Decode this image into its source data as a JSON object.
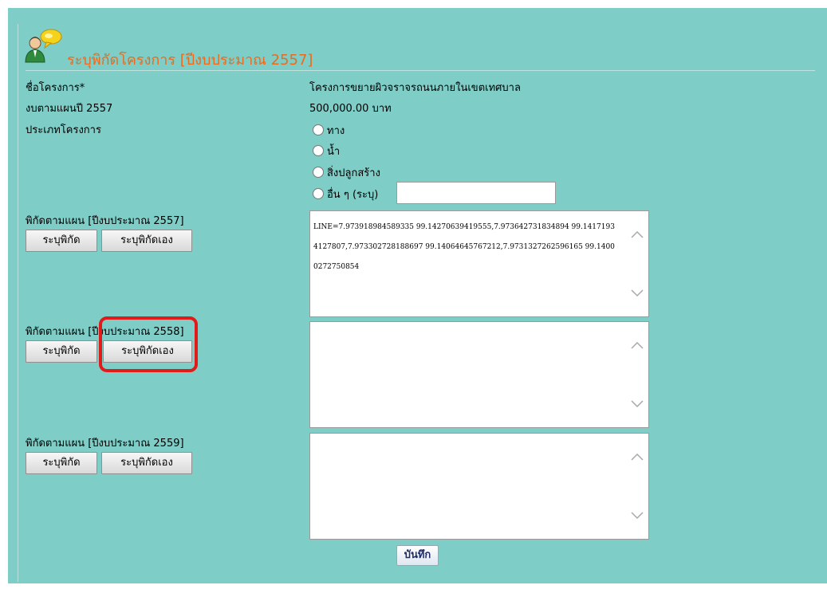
{
  "title": "ระบุพิกัดโครงการ [ปีงบประมาณ 2557]",
  "fields": {
    "project_name_label": "ชื่อโครงการ*",
    "project_name_value": "โครงการขยายผิวจราจรถนนภายในเขตเทศบาล",
    "budget_label": "งบตามแผนปี 2557",
    "budget_value": "500,000.00 บาท",
    "type_label": "ประเภทโครงการ"
  },
  "project_types": [
    "ทาง",
    "น้ำ",
    "สิ่งปลูกสร้าง",
    "อื่น ๆ (ระบุ)"
  ],
  "other_type_value": "",
  "sections": [
    {
      "label": "พิกัดตามแผน [ปีงบประมาณ 2557]",
      "btn_specify": "ระบุพิกัด",
      "btn_specify_self": "ระบุพิกัดเอง",
      "coords": "LINE=7.973918984589335 99.14270639419555,7.973642731834894 99.14171934127807,7.973302728188697 99.14064645767212,7.9731327262596165 99.14000272750854"
    },
    {
      "label": "พิกัดตามแผน [ปีงบประมาณ 2558]",
      "btn_specify": "ระบุพิกัด",
      "btn_specify_self": "ระบุพิกัดเอง",
      "coords": ""
    },
    {
      "label": "พิกัดตามแผน [ปีงบประมาณ 2559]",
      "btn_specify": "ระบุพิกัด",
      "btn_specify_self": "ระบุพิกัดเอง",
      "coords": ""
    }
  ],
  "save_label": "บันทึก",
  "icons": {
    "title_icon": "user-chat-icon",
    "scroll_up": "chevron-up-icon",
    "scroll_down": "chevron-down-icon"
  },
  "colors": {
    "background": "#7ecdc7",
    "title": "#ec6a1c",
    "highlight": "#e21a1a"
  }
}
